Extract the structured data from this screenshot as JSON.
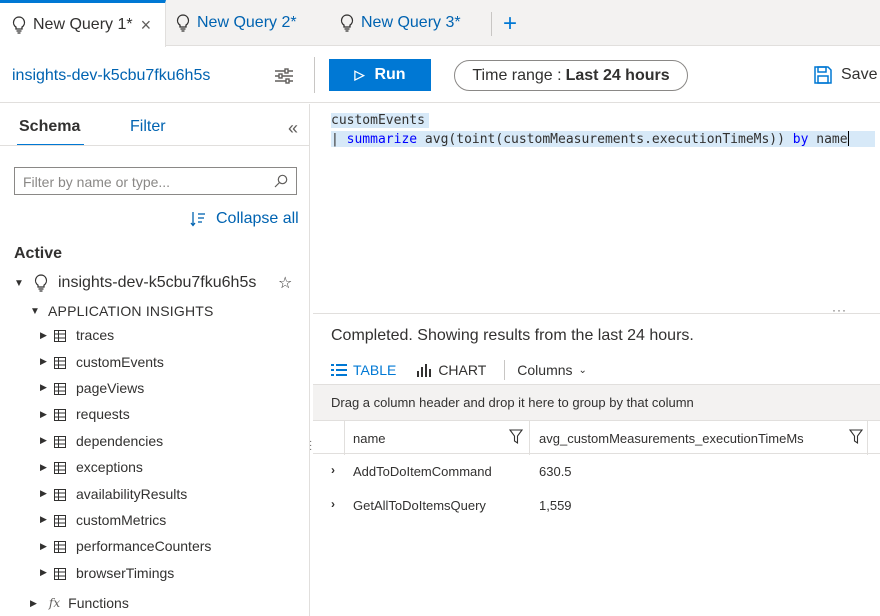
{
  "tabs": [
    {
      "label": "New Query 1*",
      "active": true,
      "closable": true
    },
    {
      "label": "New Query 2*",
      "active": false
    },
    {
      "label": "New Query 3*",
      "active": false
    }
  ],
  "toolbar": {
    "scope": "insights-dev-k5cbu7fku6h5s",
    "run_label": "Run",
    "time_range_prefix": "Time range :",
    "time_range_value": "Last 24 hours",
    "save_label": "Save"
  },
  "schema_panel": {
    "tab_schema": "Schema",
    "tab_filter": "Filter",
    "filter_placeholder": "Filter by name or type...",
    "collapse_all": "Collapse all",
    "active_header": "Active",
    "workspace": "insights-dev-k5cbu7fku6h5s",
    "section": "APPLICATION INSIGHTS",
    "tables": [
      "traces",
      "customEvents",
      "pageViews",
      "requests",
      "dependencies",
      "exceptions",
      "availabilityResults",
      "customMetrics",
      "performanceCounters",
      "browserTimings"
    ],
    "functions_label": "Functions"
  },
  "editor": {
    "line1": "customEvents",
    "line2_pipe": "| ",
    "line2_kw1": "summarize",
    "line2_mid": " avg(toint(customMeasurements.executionTimeMs)) ",
    "line2_kw2": "by",
    "line2_end": " name"
  },
  "results": {
    "status": "Completed. Showing results from the last 24 hours.",
    "tab_table": "TABLE",
    "tab_chart": "CHART",
    "columns_label": "Columns",
    "group_hint": "Drag a column header and drop it here to group by that column",
    "columns": [
      "name",
      "avg_customMeasurements_executionTimeMs"
    ],
    "rows": [
      {
        "name": "AddToDoItemCommand",
        "value": "630.5"
      },
      {
        "name": "GetAllToDoItemsQuery",
        "value": "1,559"
      }
    ]
  },
  "colors": {
    "accent": "#0078d4",
    "link": "#0063b1",
    "selection": "#d7e9f8"
  }
}
